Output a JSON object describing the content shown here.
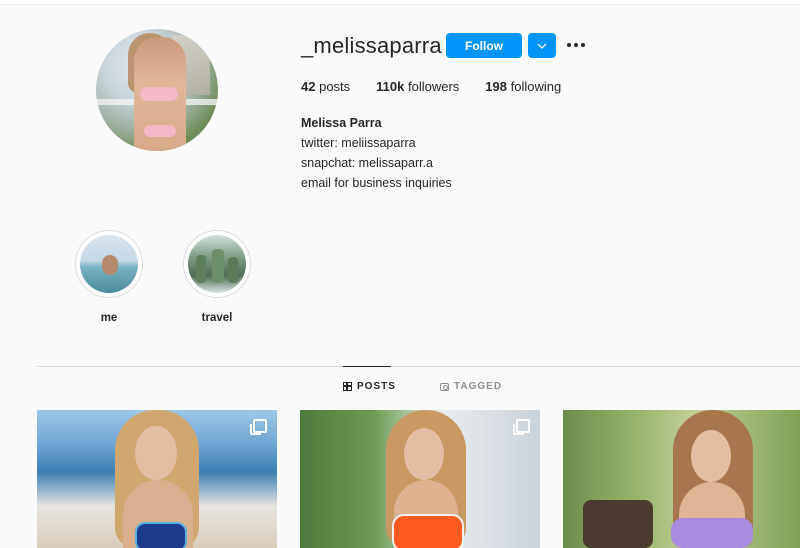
{
  "profile": {
    "username": "_melissaparra",
    "follow_label": "Follow",
    "stats": {
      "posts_count": "42",
      "posts_label": "posts",
      "followers_count": "110k",
      "followers_label": "followers",
      "following_count": "198",
      "following_label": "following"
    },
    "bio": {
      "name": "Melissa Parra",
      "lines": [
        "twitter: meliissaparra",
        "snapchat: melissaparr.a",
        "email for business inquiries"
      ]
    }
  },
  "highlights": [
    {
      "label": "me"
    },
    {
      "label": "travel"
    }
  ],
  "tabs": [
    {
      "label": "POSTS",
      "icon": "grid-icon",
      "active": true
    },
    {
      "label": "TAGGED",
      "icon": "tag-icon",
      "active": false
    }
  ],
  "colors": {
    "accent": "#0095f6",
    "background": "#fafafa",
    "text": "#262626",
    "muted": "#8e8e8e"
  },
  "posts": [
    {
      "icon": "multiple-images-icon"
    },
    {
      "icon": "multiple-images-icon"
    },
    {
      "icon": null
    }
  ]
}
